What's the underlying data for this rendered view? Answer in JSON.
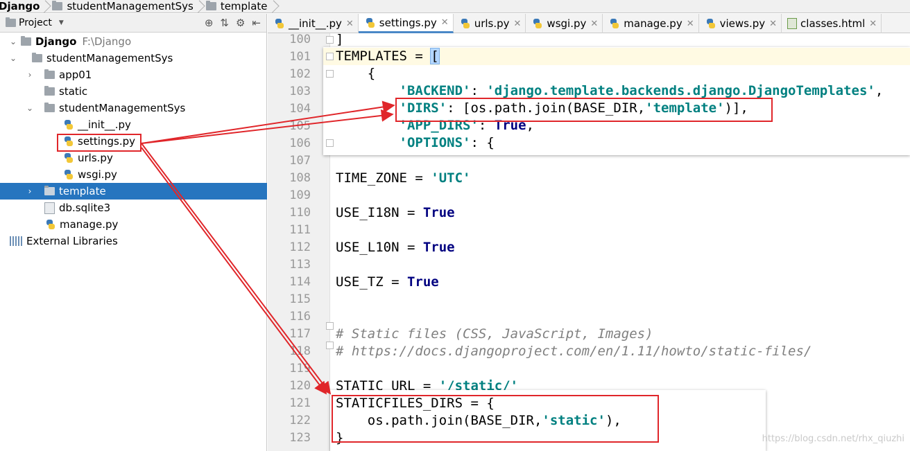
{
  "breadcrumbs": [
    "Django",
    "studentManagementSys",
    "template"
  ],
  "project_panel": {
    "title": "Project",
    "tree": [
      {
        "label": "Django",
        "path": "F:\\Django",
        "icon": "folder-icon"
      },
      {
        "label": "studentManagementSys",
        "icon": "folder-icon"
      },
      {
        "label": "app01",
        "icon": "folder-icon"
      },
      {
        "label": "static",
        "icon": "folder-icon"
      },
      {
        "label": "studentManagementSys",
        "icon": "folder-icon"
      },
      {
        "label": "__init__.py",
        "icon": "python-file-icon"
      },
      {
        "label": "settings.py",
        "icon": "python-file-icon"
      },
      {
        "label": "urls.py",
        "icon": "python-file-icon"
      },
      {
        "label": "wsgi.py",
        "icon": "python-file-icon"
      },
      {
        "label": "template",
        "icon": "folder-icon",
        "selected": true
      },
      {
        "label": "db.sqlite3",
        "icon": "file-icon"
      },
      {
        "label": "manage.py",
        "icon": "python-file-icon"
      },
      {
        "label": "External Libraries",
        "icon": "library-icon"
      }
    ]
  },
  "tabs": [
    {
      "label": "__init__.py"
    },
    {
      "label": "settings.py",
      "active": true
    },
    {
      "label": "urls.py"
    },
    {
      "label": "wsgi.py"
    },
    {
      "label": "manage.py"
    },
    {
      "label": "views.py"
    },
    {
      "label": "classes.html"
    }
  ],
  "editor": {
    "line_numbers": [
      "100",
      "101",
      "102",
      "103",
      "104",
      "105",
      "106",
      "107",
      "108",
      "109",
      "110",
      "111",
      "112",
      "113",
      "114",
      "115",
      "116",
      "117",
      "118",
      "119",
      "120",
      "121",
      "122",
      "123"
    ],
    "lines": {
      "l100": "]",
      "l108_a": "TIME_ZONE = ",
      "l108_b": "'UTC'",
      "l110_a": "USE_I18N = ",
      "l110_b": "True",
      "l112_a": "USE_L10N = ",
      "l112_b": "True",
      "l114_a": "USE_TZ = ",
      "l114_b": "True",
      "l117": "# Static files (CSS, JavaScript, Images)",
      "l118": "# https://docs.djangoproject.com/en/1.11/howto/static-files/",
      "l120_a": "STATIC_URL = ",
      "l120_b": "'/static/'"
    },
    "templates_popup": {
      "l101_a": "TEMPLATES = ",
      "l101_b": "[",
      "l102": "    {",
      "l103_a": "        'BACKEND'",
      "l103_b": ": ",
      "l103_c": "'django.template.backends.django.DjangoTemplates'",
      "l103_d": ",",
      "l104_a": "        'DIRS'",
      "l104_b": ": [os.path.join(BASE_DIR,",
      "l104_c": "'template'",
      "l104_d": ")],",
      "l105_a": "        'APP_DIRS'",
      "l105_b": ": ",
      "l105_c": "True",
      "l105_d": ",",
      "l106_a": "        'OPTIONS'",
      "l106_b": ": {"
    },
    "staticfiles_popup": {
      "l121": "STATICFILES_DIRS = {",
      "l122_a": "    os.path.join(BASE_DIR,",
      "l122_b": "'static'",
      "l122_c": "),",
      "l123": "}"
    }
  },
  "watermark": "https://blog.csdn.net/rhx_qiuzhi",
  "colors": {
    "annotation_red": "#e0262a",
    "selection_blue": "#2675bf"
  }
}
